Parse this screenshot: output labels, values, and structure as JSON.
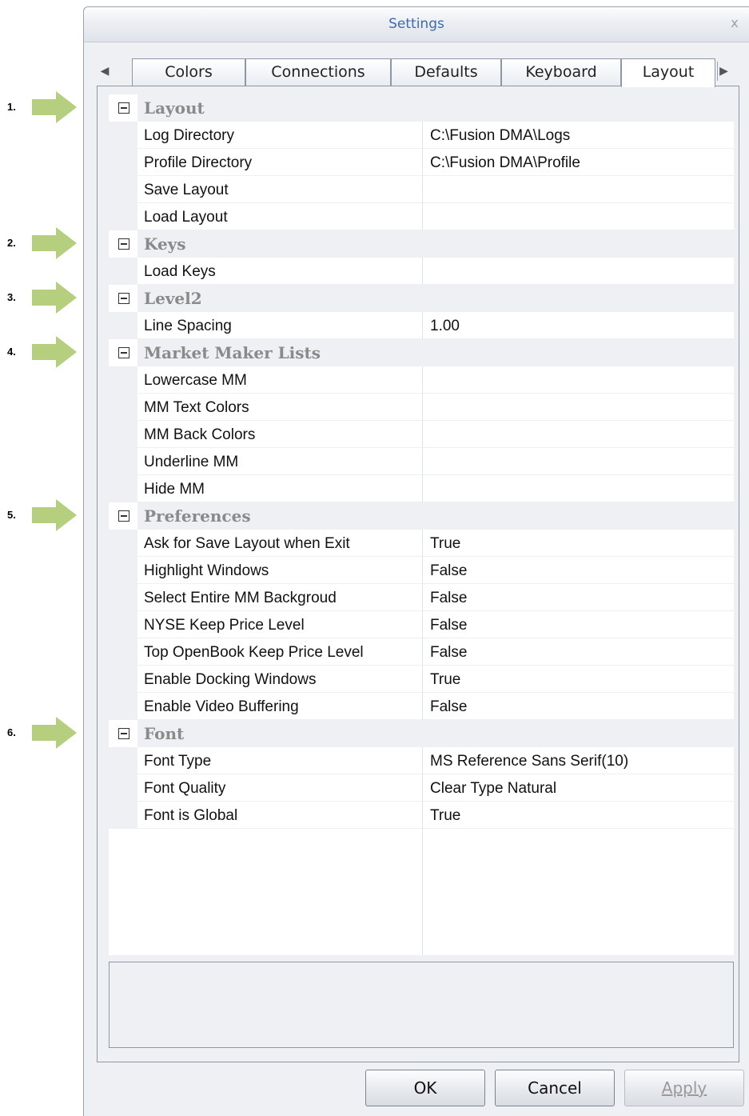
{
  "window": {
    "title": "Settings",
    "close_glyph": "x"
  },
  "tabs": [
    {
      "label": "Colors",
      "active": false
    },
    {
      "label": "Connections",
      "active": false
    },
    {
      "label": "Defaults",
      "active": false
    },
    {
      "label": "Keyboard",
      "active": false
    },
    {
      "label": "Layout",
      "active": true
    }
  ],
  "annotations": [
    "1.",
    "2.",
    "3.",
    "4.",
    "5.",
    "6."
  ],
  "categories": [
    {
      "name": "Layout",
      "properties": [
        {
          "name": "Log Directory",
          "value": "C:\\Fusion DMA\\Logs"
        },
        {
          "name": "Profile Directory",
          "value": "C:\\Fusion DMA\\Profile"
        },
        {
          "name": "Save Layout",
          "value": ""
        },
        {
          "name": "Load Layout",
          "value": ""
        }
      ]
    },
    {
      "name": "Keys",
      "properties": [
        {
          "name": "Load Keys",
          "value": ""
        }
      ]
    },
    {
      "name": "Level2",
      "properties": [
        {
          "name": "Line Spacing",
          "value": "1.00"
        }
      ]
    },
    {
      "name": "Market Maker Lists",
      "properties": [
        {
          "name": "Lowercase MM",
          "value": ""
        },
        {
          "name": "MM Text Colors",
          "value": ""
        },
        {
          "name": "MM Back Colors",
          "value": ""
        },
        {
          "name": "Underline MM",
          "value": ""
        },
        {
          "name": "Hide MM",
          "value": ""
        }
      ]
    },
    {
      "name": "Preferences",
      "properties": [
        {
          "name": "Ask for Save Layout when Exit",
          "value": "True"
        },
        {
          "name": "Highlight Windows",
          "value": "False"
        },
        {
          "name": "Select Entire MM Backgroud",
          "value": "False"
        },
        {
          "name": "NYSE Keep Price Level",
          "value": "False"
        },
        {
          "name": "Top OpenBook Keep Price Level",
          "value": "False"
        },
        {
          "name": "Enable Docking Windows",
          "value": "True"
        },
        {
          "name": "Enable Video Buffering",
          "value": "False"
        }
      ]
    },
    {
      "name": "Font",
      "properties": [
        {
          "name": "Font Type",
          "value": "MS Reference Sans Serif(10)"
        },
        {
          "name": "Font Quality",
          "value": "Clear Type Natural"
        },
        {
          "name": "Font is Global",
          "value": "True"
        }
      ]
    }
  ],
  "buttons": {
    "ok": "OK",
    "cancel": "Cancel",
    "apply": "Apply"
  },
  "colors": {
    "title": "#3b6bb0",
    "category_text": "#8a8a8a",
    "arrow": "#b5cf7e"
  },
  "icons": {
    "tab_left": "triangle-left",
    "tab_right": "triangle-right",
    "collapse": "minus-box"
  }
}
